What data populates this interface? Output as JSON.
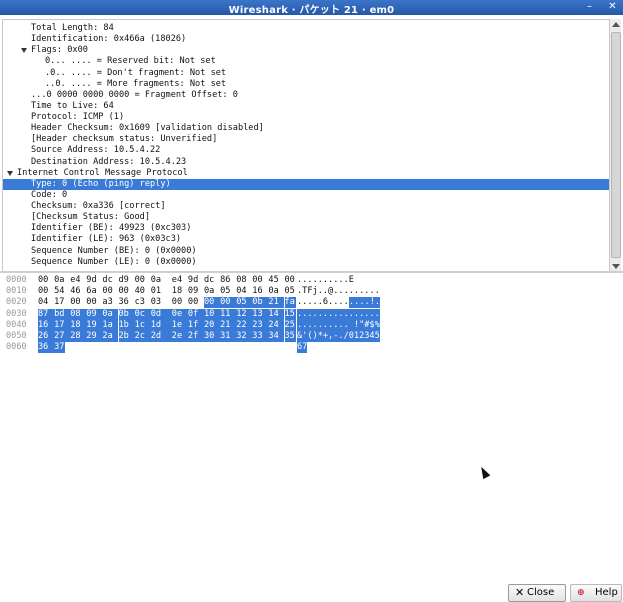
{
  "window": {
    "title": "Wireshark · パケット 21 · em0"
  },
  "detail_lines": [
    {
      "indent": 28,
      "text": "Total Length: 84"
    },
    {
      "indent": 28,
      "text": "Identification: 0x466a (18026)"
    },
    {
      "indent": 28,
      "text": "Flags: 0x00",
      "expanded": true
    },
    {
      "indent": 42,
      "text": "0... .... = Reserved bit: Not set"
    },
    {
      "indent": 42,
      "text": ".0.. .... = Don't fragment: Not set"
    },
    {
      "indent": 42,
      "text": "..0. .... = More fragments: Not set"
    },
    {
      "indent": 28,
      "text": "...0 0000 0000 0000 = Fragment Offset: 0"
    },
    {
      "indent": 28,
      "text": "Time to Live: 64"
    },
    {
      "indent": 28,
      "text": "Protocol: ICMP (1)"
    },
    {
      "indent": 28,
      "text": "Header Checksum: 0x1609 [validation disabled]"
    },
    {
      "indent": 28,
      "text": "[Header checksum status: Unverified]"
    },
    {
      "indent": 28,
      "text": "Source Address: 10.5.4.22"
    },
    {
      "indent": 28,
      "text": "Destination Address: 10.5.4.23"
    },
    {
      "indent": 14,
      "text": "Internet Control Message Protocol",
      "expanded": true
    },
    {
      "indent": 28,
      "text": "Type: 0 (Echo (ping) reply)",
      "selected": true
    },
    {
      "indent": 28,
      "text": "Code: 0"
    },
    {
      "indent": 28,
      "text": "Checksum: 0xa336 [correct]"
    },
    {
      "indent": 28,
      "text": "[Checksum Status: Good]"
    },
    {
      "indent": 28,
      "text": "Identifier (BE): 49923 (0xc303)"
    },
    {
      "indent": 28,
      "text": "Identifier (LE): 963 (0x03c3)"
    },
    {
      "indent": 28,
      "text": "Sequence Number (BE): 0 (0x0000)"
    },
    {
      "indent": 28,
      "text": "Sequence Number (LE): 0 (0x0000)"
    }
  ],
  "hex_rows": [
    {
      "offset": "0000",
      "bytes": [
        "00",
        "0a",
        "e4",
        "9d",
        "dc",
        "d9",
        "00",
        "0a",
        "e4",
        "9d",
        "dc",
        "86",
        "08",
        "00",
        "45",
        "00"
      ],
      "hl_start": 99,
      "ascii": [
        {
          "t": "..........E",
          "hl": false
        }
      ]
    },
    {
      "offset": "0010",
      "bytes": [
        "00",
        "54",
        "46",
        "6a",
        "00",
        "00",
        "40",
        "01",
        "18",
        "09",
        "0a",
        "05",
        "04",
        "16",
        "0a",
        "05"
      ],
      "hl_start": 99,
      "ascii": [
        {
          "t": ".TFj..@.........",
          "hl": false
        }
      ]
    },
    {
      "offset": "0020",
      "bytes": [
        "04",
        "17",
        "00",
        "00",
        "a3",
        "36",
        "c3",
        "03",
        "00",
        "00",
        "00",
        "00",
        "05",
        "0b",
        "21",
        "fa"
      ],
      "hl_start": 10,
      "ascii": [
        {
          "t": ".....6....",
          "hl": false
        },
        {
          "t": "....!.",
          "hl": true
        }
      ]
    },
    {
      "offset": "0030",
      "bytes": [
        "87",
        "bd",
        "08",
        "09",
        "0a",
        "0b",
        "0c",
        "0d",
        "0e",
        "0f",
        "10",
        "11",
        "12",
        "13",
        "14",
        "15"
      ],
      "hl_start": 0,
      "ascii": [
        {
          "t": "................",
          "hl": true
        }
      ]
    },
    {
      "offset": "0040",
      "bytes": [
        "16",
        "17",
        "18",
        "19",
        "1a",
        "1b",
        "1c",
        "1d",
        "1e",
        "1f",
        "20",
        "21",
        "22",
        "23",
        "24",
        "25"
      ],
      "hl_start": 0,
      "ascii": [
        {
          "t": ".......... !\"#$%",
          "hl": true
        }
      ]
    },
    {
      "offset": "0050",
      "bytes": [
        "26",
        "27",
        "28",
        "29",
        "2a",
        "2b",
        "2c",
        "2d",
        "2e",
        "2f",
        "30",
        "31",
        "32",
        "33",
        "34",
        "35"
      ],
      "hl_start": 0,
      "ascii": [
        {
          "t": "&'()*+,-./012345",
          "hl": true
        }
      ]
    },
    {
      "offset": "0060",
      "bytes": [
        "36",
        "37"
      ],
      "hl_start": 0,
      "ascii": [
        {
          "t": "67",
          "hl": true
        }
      ]
    }
  ],
  "buttons": {
    "close_label": "Close",
    "help_label": "Help"
  },
  "colors": {
    "selection": "#3a7bd8",
    "titlebar": "#2f66b8"
  }
}
